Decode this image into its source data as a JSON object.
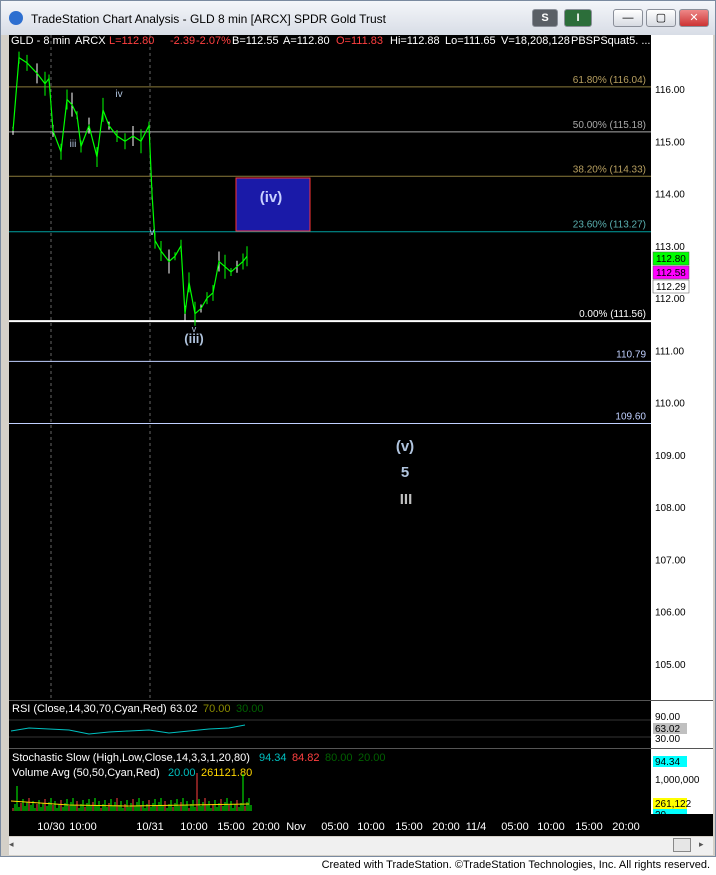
{
  "window": {
    "title": "TradeStation Chart Analysis - GLD 8 min [ARCX] SPDR Gold Trust",
    "s_button": "S",
    "i_button": "I",
    "minimize": "—",
    "maximize": "▢",
    "close": "✕"
  },
  "header": {
    "symbol": "GLD - 8 min",
    "exchange": "ARCX",
    "last": "L=112.80",
    "change": "-2.39",
    "pct": "-2.07%",
    "bid": "B=112.55",
    "ask": "A=112.80",
    "open": "O=111.83",
    "high": "Hi=112.88",
    "low": "Lo=111.65",
    "volume": "V=18,208,128",
    "study": "PBSPSquat5. ..."
  },
  "colors": {
    "green": "#00ff00",
    "red": "#ff0000",
    "cyan": "#00c0c0",
    "gold": "#b8860b",
    "box": "#1a1aa8"
  },
  "price_axis": [
    "116.00",
    "115.00",
    "114.00",
    "113.00",
    "112.00",
    "111.00",
    "110.00",
    "109.00",
    "108.00",
    "107.00",
    "106.00",
    "105.00"
  ],
  "price_tags": [
    {
      "text": "112.80",
      "bg": "#00ff00",
      "fg": "#000"
    },
    {
      "text": "112.58",
      "bg": "#ff00ff",
      "fg": "#000"
    },
    {
      "text": "112.29",
      "bg": "#ffffff",
      "fg": "#000"
    }
  ],
  "levels": [
    {
      "label": "61.80% (116.04)",
      "price": 116.04,
      "color": "#8a7a3a",
      "labelColor": "#b8a060"
    },
    {
      "label": "50.00% (115.18)",
      "price": 115.18,
      "color": "#aaaaaa",
      "labelColor": "#aaaaaa"
    },
    {
      "label": "38.20% (114.33)",
      "price": 114.33,
      "color": "#8a7a3a",
      "labelColor": "#b8a060"
    },
    {
      "label": "23.60% (113.27)",
      "price": 113.27,
      "color": "#00a0a0",
      "labelColor": "#5ab0b0"
    },
    {
      "label": "0.00% (111.56)",
      "price": 111.56,
      "color": "#ffffff",
      "labelColor": "#ffffff"
    },
    {
      "label": "110.79",
      "price": 110.79,
      "color": "#c0d0ff",
      "labelColor": "#c0d0ff"
    },
    {
      "label": "109.60",
      "price": 109.6,
      "color": "#c0d0ff",
      "labelColor": "#c0d0ff"
    }
  ],
  "annotations": {
    "box": "(iv)",
    "wave_v": "(v)",
    "five": "5",
    "three": "III",
    "iii_paren": "(iii)",
    "small_iii": "iii",
    "small_iv": "iv",
    "small_v": "v",
    "small_vdot": "v"
  },
  "rsi": {
    "label": "RSI (Close,14,30,70,Cyan,Red)",
    "value": "63.02",
    "ob": "70.00",
    "os": "30.00",
    "axis": [
      "90.00",
      "30.00"
    ],
    "tag": "63.02"
  },
  "stoch": {
    "label": "Stochastic Slow (High,Low,Close,14,3,3,1,20,80)",
    "k": "94.34",
    "d": "84.82",
    "ob": "80.00",
    "os": "20.00",
    "tag": "94.34"
  },
  "volume": {
    "label": "Volume Avg (50,50,Cyan,Red)",
    "v1": "20.00",
    "v2": "261121.80",
    "axis": "1,000,000",
    "tag1": "261,122",
    "tag2": "20"
  },
  "time_axis": [
    "10/30",
    "10:00",
    "10/31",
    "10:00",
    "15:00",
    "20:00",
    "Nov",
    "05:00",
    "10:00",
    "15:00",
    "20:00",
    "11/4",
    "05:00",
    "10:00",
    "15:00",
    "20:00"
  ],
  "footer": "Created with TradeStation. ©TradeStation Technologies, Inc. All rights reserved."
}
